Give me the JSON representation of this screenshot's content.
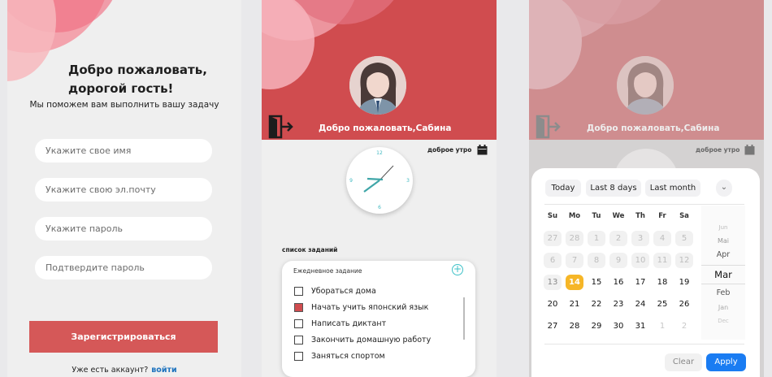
{
  "register": {
    "title_line1": "Добро пожаловать,",
    "title_line2": "дорогой гость!",
    "subtitle": "Мы поможем вам выполнить вашу задачу",
    "name_placeholder": "Укажите свое имя",
    "email_placeholder": "Укажите свою эл.почту",
    "password_placeholder": "Укажите пароль",
    "confirm_placeholder": "Подтвердите пароль",
    "register_button": "Зарегистрироваться",
    "have_account": "Уже есть аккаунт?",
    "login_link": "войти"
  },
  "home": {
    "greeting": "Добро пожаловать,Сабина",
    "good_morning": "доброе утро",
    "clock_numbers": [
      "12",
      "3",
      "6",
      "9"
    ],
    "tasks_title": "список заданий",
    "card_title": "Ежедневное задание",
    "add_icon": "+",
    "tasks": [
      {
        "label": "Убораться дома",
        "checked": false
      },
      {
        "label": "Начать учить японский язык",
        "checked": true
      },
      {
        "label": "Написать диктант",
        "checked": false
      },
      {
        "label": "Закончить домашную работу",
        "checked": false
      },
      {
        "label": "Заняться спортом",
        "checked": false
      }
    ],
    "accent_color": "#d04c4f"
  },
  "datepicker": {
    "greeting": "Добро пожаловать,Сабина",
    "good_morning": "доброе утро",
    "presets": [
      "Today",
      "Last 8 days",
      "Last month"
    ],
    "chevron": "⌄",
    "weekdays": [
      "Su",
      "Mo",
      "Tu",
      "We",
      "Th",
      "Fr",
      "Sa"
    ],
    "weeks": [
      [
        "27",
        "28",
        "1",
        "2",
        "3",
        "4",
        "5"
      ],
      [
        "6",
        "7",
        "8",
        "9",
        "10",
        "11",
        "12"
      ],
      [
        "13",
        "14",
        "15",
        "16",
        "17",
        "18",
        "19"
      ],
      [
        "20",
        "21",
        "22",
        "23",
        "24",
        "25",
        "26"
      ],
      [
        "27",
        "28",
        "29",
        "30",
        "31",
        "1",
        "2"
      ]
    ],
    "selected_day": "14",
    "months": [
      "Jun",
      "Mai",
      "Apr",
      "Mar",
      "Feb",
      "Jan",
      "Dec"
    ],
    "selected_month": "Mar",
    "clear_button": "Clear",
    "apply_button": "Apply",
    "apply_color": "#1a7cf2",
    "selected_color": "#f6b627"
  }
}
